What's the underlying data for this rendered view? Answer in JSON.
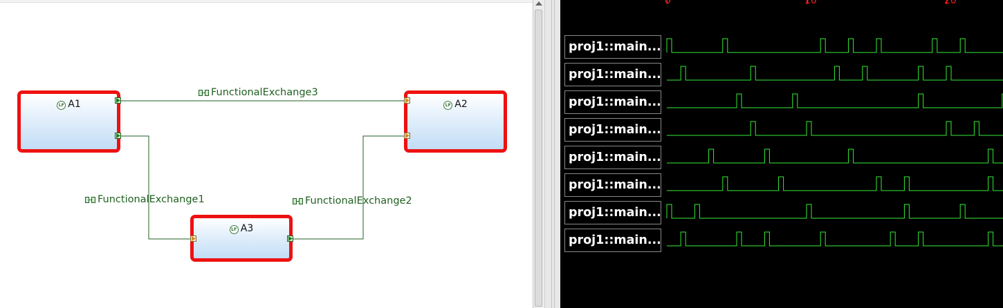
{
  "diagram": {
    "functions": [
      {
        "id": "A1",
        "label": "A1"
      },
      {
        "id": "A2",
        "label": "A2"
      },
      {
        "id": "A3",
        "label": "A3"
      }
    ],
    "exchanges": [
      {
        "id": "fe3",
        "label": "FunctionalExchange3",
        "from": "A1",
        "to": "A2"
      },
      {
        "id": "fe1",
        "label": "FunctionalExchange1",
        "from": "A1",
        "to": "A3"
      },
      {
        "id": "fe2",
        "label": "FunctionalExchange2",
        "from": "A3",
        "to": "A2"
      }
    ],
    "function_icon": "lf-function-icon",
    "exchange_icon": "functional-exchange-icon",
    "colors": {
      "function_border": "#ee1111",
      "exchange_line": "#1f5f1f"
    }
  },
  "waveform": {
    "time_ticks": [
      "0",
      "10",
      "20"
    ],
    "signals": [
      {
        "name": "proj1::main...",
        "pulses": [
          0,
          4,
          11,
          13,
          15,
          19,
          21
        ]
      },
      {
        "name": "proj1::main...",
        "pulses": [
          1,
          6,
          12,
          14,
          18,
          20
        ]
      },
      {
        "name": "proj1::main...",
        "pulses": [
          5,
          9,
          18,
          24
        ]
      },
      {
        "name": "proj1::main...",
        "pulses": [
          6,
          10,
          20,
          22
        ]
      },
      {
        "name": "proj1::main...",
        "pulses": [
          3,
          7,
          13,
          23
        ]
      },
      {
        "name": "proj1::main...",
        "pulses": [
          4,
          8,
          15,
          17,
          23
        ]
      },
      {
        "name": "proj1::main...",
        "pulses": [
          0,
          2,
          10,
          17,
          21
        ]
      },
      {
        "name": "proj1::main...",
        "pulses": [
          1,
          5,
          7,
          11,
          16,
          18,
          23
        ]
      }
    ],
    "colors": {
      "background": "#000000",
      "trace": "#33ee33",
      "ticks": "#ff2020",
      "label_text": "#ffffff"
    }
  }
}
